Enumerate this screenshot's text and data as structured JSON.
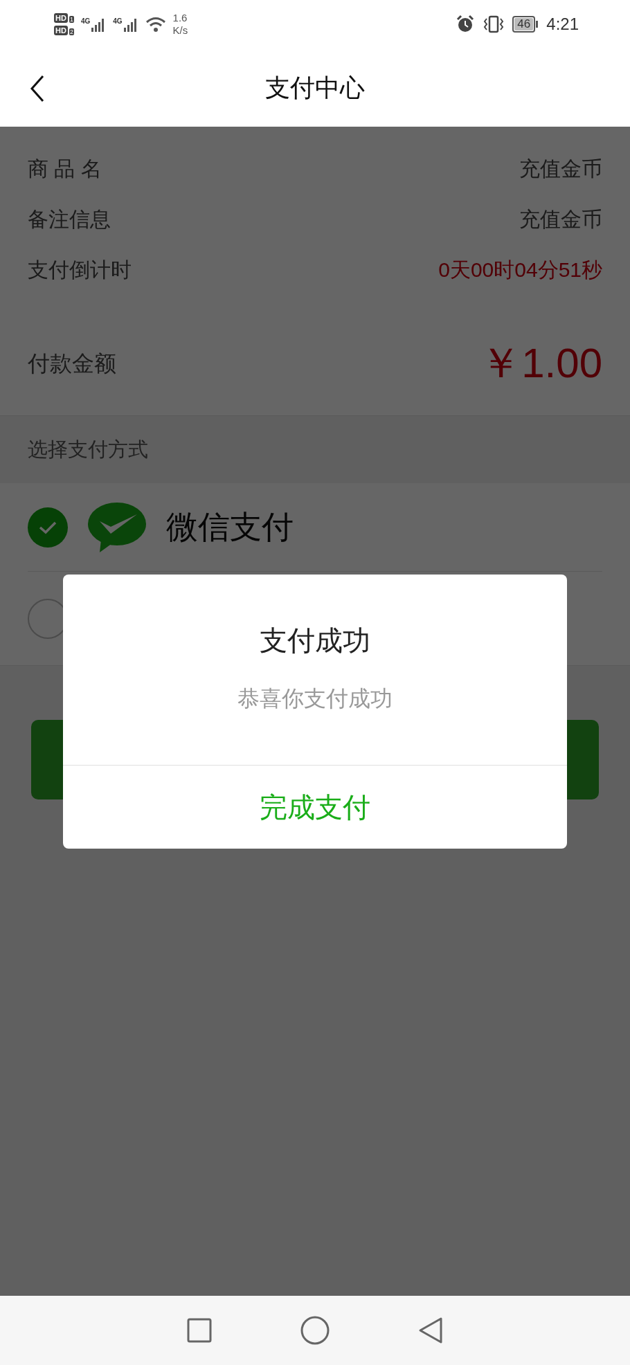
{
  "status_bar": {
    "sims": [
      {
        "label": "HD",
        "slot": "1"
      },
      {
        "label": "HD",
        "slot": "2"
      }
    ],
    "networks": [
      "4G",
      "4G"
    ],
    "speed": [
      "1.6",
      "K/s"
    ],
    "battery": "46",
    "time": "4:21"
  },
  "header": {
    "title": "支付中心"
  },
  "order": [
    {
      "label": "商 品 名",
      "value": "充值金币",
      "kind": "plain"
    },
    {
      "label": "备注信息",
      "value": "充值金币",
      "kind": "plain"
    },
    {
      "label": "支付倒计时",
      "value": "0天00时04分51秒",
      "kind": "countdown"
    }
  ],
  "amount": {
    "label": "付款金额",
    "value": "￥1.00"
  },
  "payment_section": {
    "title": "选择支付方式"
  },
  "payment_methods": [
    {
      "kind": "wechat",
      "label": "微信支付",
      "selected": true
    },
    {
      "kind": "other",
      "selected": false
    }
  ],
  "dialog": {
    "title": "支付成功",
    "message": "恭喜你支付成功",
    "button": "完成支付"
  }
}
